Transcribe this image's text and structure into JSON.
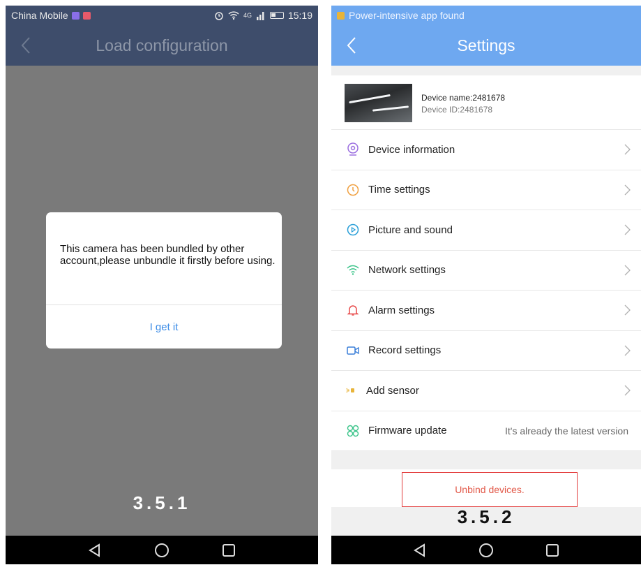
{
  "left": {
    "status": {
      "carrier": "China Mobile",
      "network": "4G",
      "time": "15:19"
    },
    "title": "Load configuration",
    "dialog": {
      "message": "This camera has been bundled by other account,please unbundle it firstly before using.",
      "button": "I get it"
    },
    "caption": "3.5.1"
  },
  "right": {
    "status": {
      "notice": "Power-intensive app found"
    },
    "title": "Settings",
    "device": {
      "name": "Device name:2481678",
      "id": "Device ID:2481678"
    },
    "menu": [
      {
        "label": "Device information",
        "icon": "camera-icon"
      },
      {
        "label": "Time settings",
        "icon": "clock-icon"
      },
      {
        "label": "Picture and sound",
        "icon": "play-icon"
      },
      {
        "label": "Network settings",
        "icon": "wifi-icon"
      },
      {
        "label": "Alarm settings",
        "icon": "bell-icon"
      },
      {
        "label": "Record settings",
        "icon": "video-icon"
      },
      {
        "label": "Add sensor",
        "icon": "sensor-icon"
      },
      {
        "label": "Firmware update",
        "icon": "firmware-icon",
        "value": "It's already the latest version"
      }
    ],
    "unbind": "Unbind devices.",
    "caption": "3.5.2"
  },
  "colors": {
    "left_header": "#3e4d6b",
    "right_header": "#6ea8f0",
    "accent_blue": "#3c8ce6",
    "unbind_red": "#e23a3a"
  }
}
